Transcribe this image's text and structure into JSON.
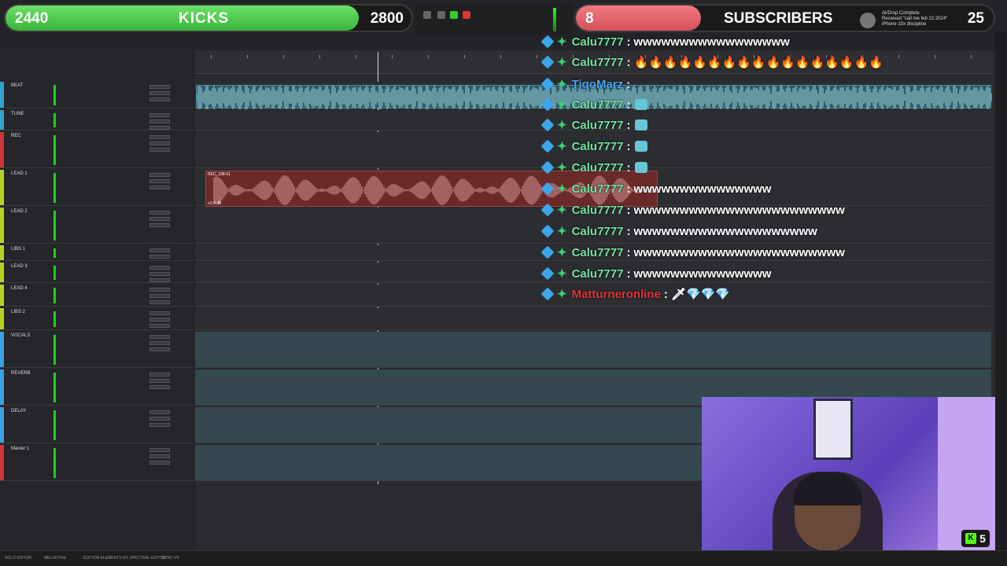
{
  "kicks_goal": {
    "current": "2440",
    "label": "KICKS",
    "target": "2800",
    "progress": 0.87
  },
  "subs_goal": {
    "current": "8",
    "label": "SUBSCRIBERS",
    "target": "25",
    "progress": 0.3
  },
  "airdrop": {
    "line1": "AirDrop Complete",
    "line2": "Received \"call me feb 22 2024\"",
    "line3": "iPhone 10x discipline"
  },
  "tracks": [
    {
      "name": "BEAT",
      "color": "#33a2c8"
    },
    {
      "name": "TUNE",
      "color": "#33a2c8"
    },
    {
      "name": "REC",
      "color": "#d0343c"
    },
    {
      "name": "LEAD 1",
      "color": "#b8d028"
    },
    {
      "name": "LEAD 2",
      "color": "#b8d028"
    },
    {
      "name": "LIBS 1",
      "color": "#b8d028"
    },
    {
      "name": "LEAD 3",
      "color": "#b8d028"
    },
    {
      "name": "LEAD 4",
      "color": "#b8d028"
    },
    {
      "name": "LIBS 2",
      "color": "#b8d028"
    },
    {
      "name": "VOCALS",
      "color": "#3aa0e0"
    },
    {
      "name": "REVERB",
      "color": "#3aa0e0"
    },
    {
      "name": "DELAY",
      "color": "#3aa0e0"
    },
    {
      "name": "Master 1",
      "color": "#d0343c"
    }
  ],
  "clips": {
    "rec": "REC_108-01",
    "rec_gain": "+2.8 dB"
  },
  "chat": [
    {
      "user": "Calu7777",
      "text": "wwwwwwwwwwwwwwwww",
      "kind": "text"
    },
    {
      "user": "Calu7777",
      "text": "🔥🔥🔥🔥🔥🔥🔥🔥🔥🔥🔥🔥🔥🔥🔥🔥🔥",
      "kind": "fire"
    },
    {
      "user": "TigoMarz",
      "text": "",
      "kind": "tigo"
    },
    {
      "user": "Calu7777",
      "text": "",
      "kind": "emote"
    },
    {
      "user": "Calu7777",
      "text": "",
      "kind": "emote"
    },
    {
      "user": "Calu7777",
      "text": "",
      "kind": "emote"
    },
    {
      "user": "Calu7777",
      "text": "",
      "kind": "emote"
    },
    {
      "user": "Calu7777",
      "text": "wwwwwwwwwwwwwww",
      "kind": "text"
    },
    {
      "user": "Calu7777",
      "text": "wwwwwwwwwwwwwwwwwwwwwww",
      "kind": "text"
    },
    {
      "user": "Calu7777",
      "text": "wwwwwwwwwwwwwwwwwwww",
      "kind": "text"
    },
    {
      "user": "Calu7777",
      "text": "wwwwwwwwwwwwwwwwwwwwwww",
      "kind": "text"
    },
    {
      "user": "Calu7777",
      "text": "wwwwwwwwwwwwwww",
      "kind": "text"
    },
    {
      "user": "Matturneronline",
      "text": "🗡💎💎💎",
      "kind": "mattu"
    }
  ],
  "webcam": {
    "kick_count": "5"
  },
  "status": {
    "bottom_tabs": [
      "SOLO EDITOR",
      "MELODYNE",
      "EDITION ELEMENTS",
      "RX SPECTRAL EDITOR",
      "SYNC VX"
    ]
  }
}
